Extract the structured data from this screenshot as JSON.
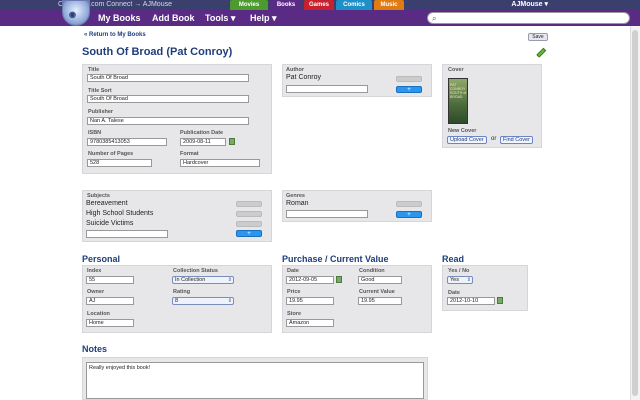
{
  "topbar": {
    "brand": "Collectorz.com Connect → AJMouse",
    "user": "AJMouse ▾",
    "tabs": [
      {
        "label": "Movies",
        "color": "#4d9a2f"
      },
      {
        "label": "Books",
        "color": "#5a2b84"
      },
      {
        "label": "Games",
        "color": "#c8202c"
      },
      {
        "label": "Comics",
        "color": "#1f8fc8"
      },
      {
        "label": "Music",
        "color": "#e07a12"
      }
    ]
  },
  "nav": {
    "my_books": "My Books",
    "add_book": "Add Book",
    "tools": "Tools ▾",
    "help": "Help ▾"
  },
  "page": {
    "return_link": "« Return to My Books",
    "save": "Save",
    "title": "South Of Broad (Pat Conroy)"
  },
  "book": {
    "title_label": "Title",
    "title_value": "South Of Broad",
    "title_sort_label": "Title Sort",
    "title_sort_value": "South Of Broad",
    "publisher_label": "Publisher",
    "publisher_value": "Nan A. Talese",
    "isbn_label": "ISBN",
    "isbn_value": "9780385413053",
    "pubdate_label": "Publication Date",
    "pubdate_value": "2009-08-11",
    "pages_label": "Number of Pages",
    "pages_value": "528",
    "format_label": "Format",
    "format_value": "Hardcover"
  },
  "author": {
    "label": "Author",
    "value": "Pat Conroy",
    "add": "+"
  },
  "cover": {
    "label": "Cover",
    "image_text": "PAT CONROY SOUTH of BROAD",
    "new_label": "New Cover",
    "upload": "Upload Cover",
    "or": "or",
    "find": "Find Cover"
  },
  "subjects": {
    "label": "Subjects",
    "items": [
      "Bereavement",
      "High School Students",
      "Suicide Victims"
    ],
    "add": "+"
  },
  "genres": {
    "label": "Genres",
    "items": [
      "Roman"
    ],
    "add": "+"
  },
  "personal": {
    "title": "Personal",
    "index_label": "Index",
    "index_value": "55",
    "status_label": "Collection Status",
    "status_value": "In Collection",
    "owner_label": "Owner",
    "owner_value": "AJ",
    "rating_label": "Rating",
    "rating_value": "8",
    "location_label": "Location",
    "location_value": "Home"
  },
  "purchase": {
    "title": "Purchase / Current Value",
    "date_label": "Date",
    "date_value": "2012-09-05",
    "condition_label": "Condition",
    "condition_value": "Good",
    "price_label": "Price",
    "price_value": "19.95",
    "current_label": "Current Value",
    "current_value": "19.95",
    "store_label": "Store",
    "store_value": "Amazon"
  },
  "read": {
    "title": "Read",
    "yesno_label": "Yes / No",
    "yesno_value": "Yes",
    "date_label": "Date",
    "date_value": "2012-10-10"
  },
  "notes": {
    "title": "Notes",
    "value": "Really enjoyed this book!"
  }
}
